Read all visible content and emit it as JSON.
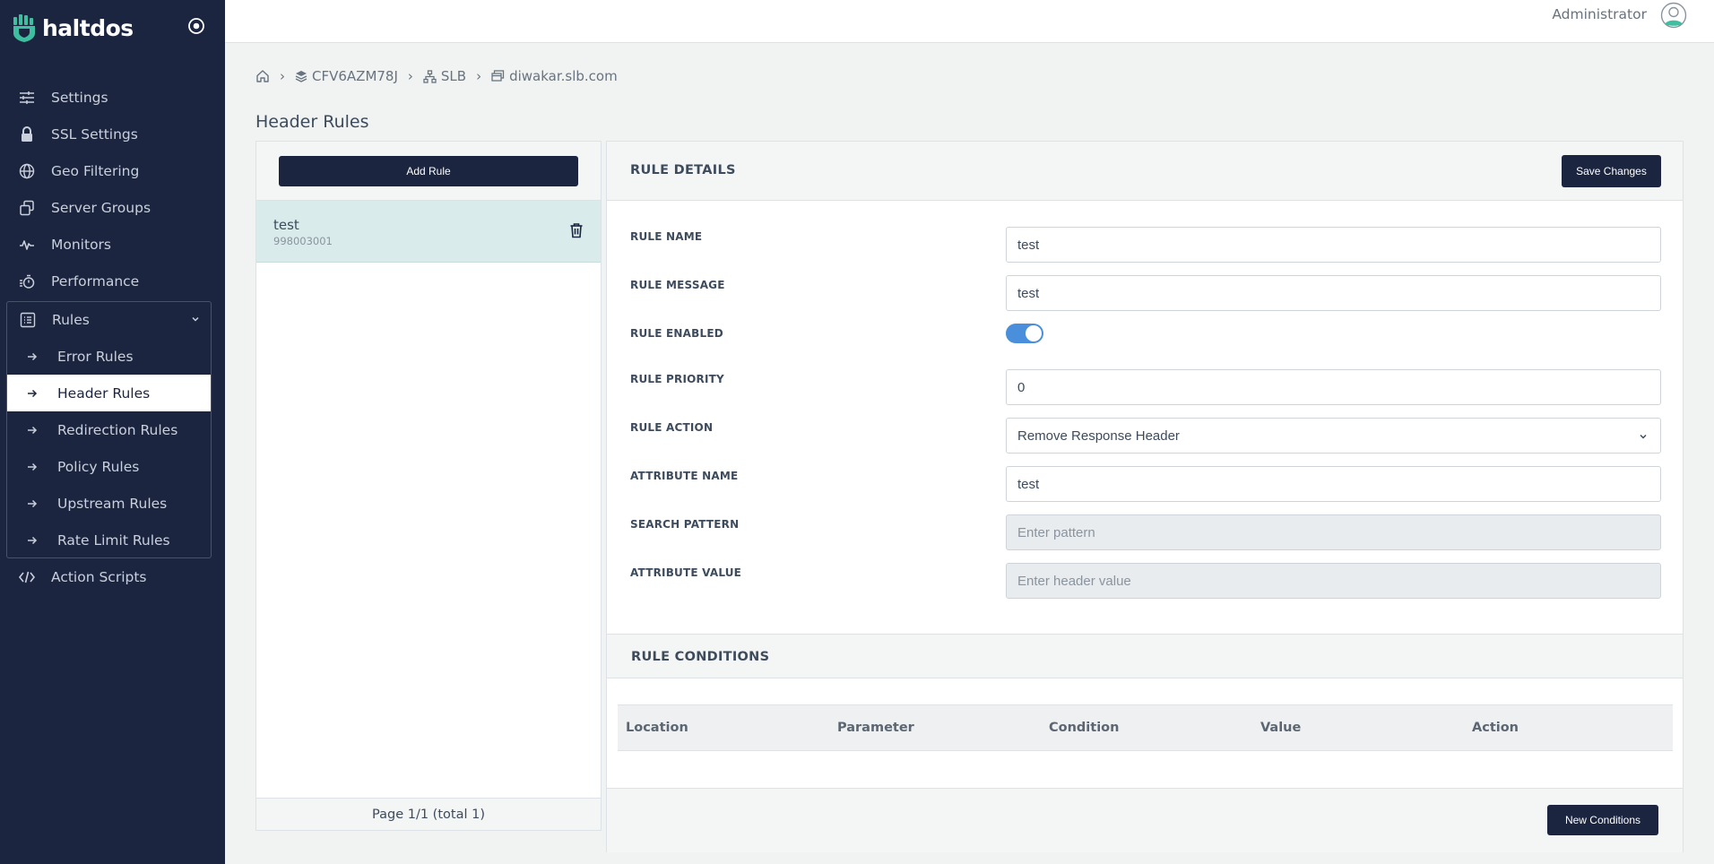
{
  "brand": {
    "name": "haltdos"
  },
  "sidebar": {
    "items": [
      {
        "label": "Settings",
        "icon": "sliders-icon"
      },
      {
        "label": "SSL Settings",
        "icon": "lock-icon"
      },
      {
        "label": "Geo Filtering",
        "icon": "globe-icon"
      },
      {
        "label": "Server Groups",
        "icon": "server-groups-icon"
      },
      {
        "label": "Monitors",
        "icon": "pulse-icon"
      },
      {
        "label": "Performance",
        "icon": "stopwatch-icon"
      }
    ],
    "rules_group": {
      "label": "Rules",
      "items": [
        {
          "label": "Error Rules"
        },
        {
          "label": "Header Rules",
          "active": true
        },
        {
          "label": "Redirection Rules"
        },
        {
          "label": "Policy Rules"
        },
        {
          "label": "Upstream Rules"
        },
        {
          "label": "Rate Limit Rules"
        }
      ]
    },
    "after": [
      {
        "label": "Action Scripts",
        "icon": "code-icon"
      }
    ]
  },
  "topbar": {
    "user": "Administrator"
  },
  "breadcrumb": {
    "sep": "›",
    "items": [
      "CFV6AZM78J",
      "SLB",
      "diwakar.slb.com"
    ]
  },
  "page": {
    "title": "Header Rules"
  },
  "rules_list": {
    "add_label": "Add Rule",
    "items": [
      {
        "name": "test",
        "id": "998003001"
      }
    ],
    "pager": "Page 1/1 (total 1)"
  },
  "details": {
    "title": "RULE DETAILS",
    "save_label": "Save Changes",
    "fields": {
      "name": {
        "label": "RULE NAME",
        "value": "test"
      },
      "message": {
        "label": "RULE MESSAGE",
        "value": "test"
      },
      "enabled": {
        "label": "RULE ENABLED",
        "value": true
      },
      "priority": {
        "label": "RULE PRIORITY",
        "value": "0"
      },
      "action": {
        "label": "RULE ACTION",
        "value": "Remove Response Header"
      },
      "attribute_name": {
        "label": "ATTRIBUTE NAME",
        "value": "test"
      },
      "search_pattern": {
        "label": "SEARCH PATTERN",
        "value": "",
        "placeholder": "Enter pattern"
      },
      "attribute_value": {
        "label": "ATTRIBUTE VALUE",
        "value": "",
        "placeholder": "Enter header value"
      }
    }
  },
  "conditions": {
    "title": "RULE CONDITIONS",
    "columns": [
      "Location",
      "Parameter",
      "Condition",
      "Value",
      "Action"
    ],
    "new_label": "New Conditions"
  },
  "colors": {
    "sidebar": "#1b2540",
    "accent": "#4a8fdb",
    "brand_teal": "#3dbfa0",
    "selected_row": "#d9eceb"
  }
}
